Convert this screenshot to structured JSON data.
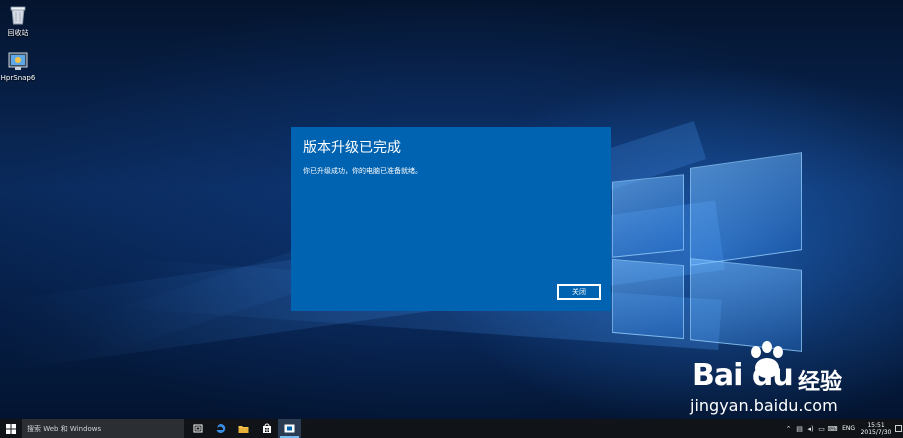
{
  "desktop": {
    "icons": [
      {
        "label": "回收站",
        "icon": "recycle-bin-icon"
      },
      {
        "label": "HprSnap6",
        "icon": "hypersnap-icon"
      }
    ]
  },
  "dialog": {
    "title": "版本升级已完成",
    "message": "你已升级成功，你的电脑已准备就绪。",
    "close_label": "关闭",
    "background": "#0063b1"
  },
  "watermark": {
    "brand": "Bai du",
    "service": "经验",
    "url": "jingyan.baidu.com"
  },
  "taskbar": {
    "search_placeholder": "搜索 Web 和 Windows",
    "apps": [
      "task-view-icon",
      "edge-icon",
      "file-explorer-icon",
      "store-icon",
      "active-app-icon"
    ],
    "tray": {
      "language": "ENG",
      "time": "15:51",
      "date": "2015/7/30"
    }
  }
}
